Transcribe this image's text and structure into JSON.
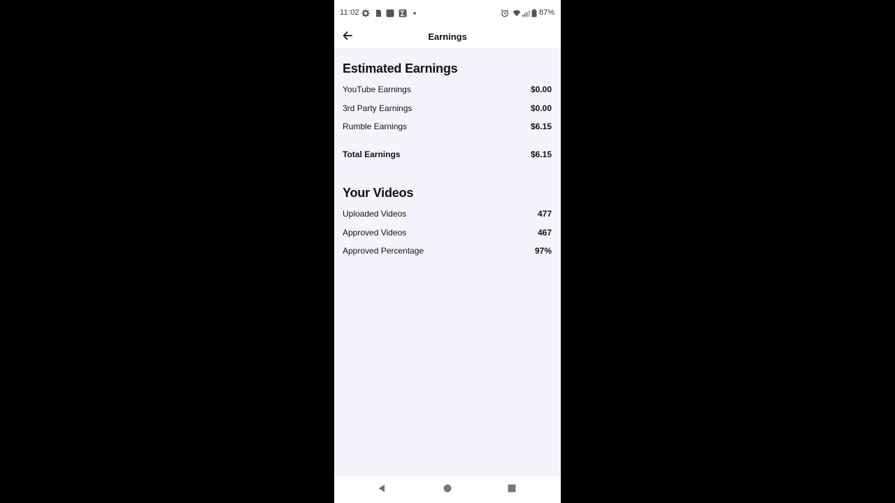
{
  "status_bar": {
    "time": "11:02",
    "battery": "87%",
    "icons": [
      "settings-icon",
      "sim-card-icon",
      "app-icon",
      "sigma-icon",
      "notification-dot-icon",
      "alarm-icon",
      "wifi-icon",
      "signal-icon",
      "battery-icon"
    ]
  },
  "app_bar": {
    "title": "Earnings",
    "back_icon": "arrow-left-icon"
  },
  "earnings": {
    "title": "Estimated Earnings",
    "rows": [
      {
        "label": "YouTube Earnings",
        "value": "$0.00"
      },
      {
        "label": "3rd Party Earnings",
        "value": "$0.00"
      },
      {
        "label": "Rumble Earnings",
        "value": "$6.15"
      }
    ],
    "total": {
      "label": "Total Earnings",
      "value": "$6.15"
    }
  },
  "videos": {
    "title": "Your Videos",
    "rows": [
      {
        "label": "Uploaded Videos",
        "value": "477"
      },
      {
        "label": "Approved Videos",
        "value": "467"
      },
      {
        "label": "Approved Percentage",
        "value": "97%"
      }
    ]
  },
  "nav_bar": {
    "icons": [
      "back-triangle-icon",
      "home-circle-icon",
      "recents-square-icon"
    ]
  },
  "colors": {
    "background": "#000000",
    "content_background": "#f4f4fc",
    "bar_background": "#ffffff",
    "text": "#111111"
  }
}
